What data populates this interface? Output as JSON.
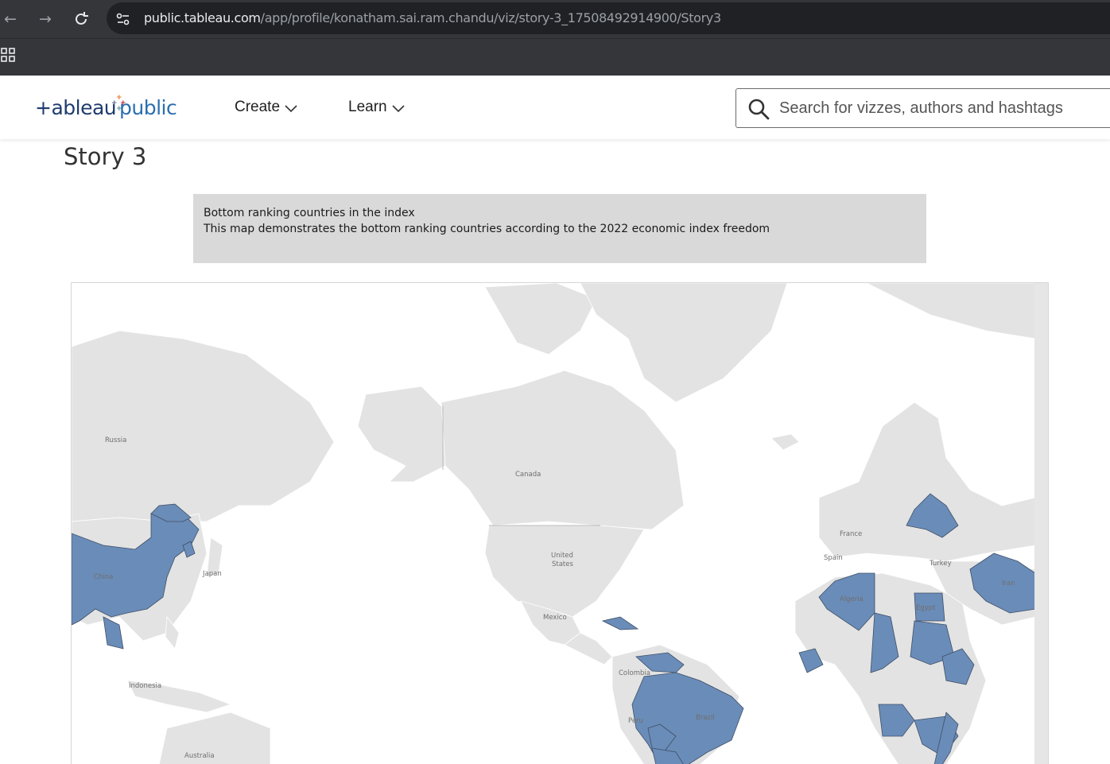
{
  "browser": {
    "url_host": "public.tableau.com",
    "url_path": "/app/profile/konatham.sai.ram.chandu/viz/story-3_17508492914900/Story3"
  },
  "header": {
    "logo_text_left": "+ableau",
    "logo_text_right": "public",
    "nav": [
      {
        "label": "Create"
      },
      {
        "label": "Learn"
      }
    ],
    "search_placeholder": "Search for vizzes, authors and hashtags"
  },
  "page": {
    "title": "Story 3",
    "caption": {
      "line1": "Bottom ranking countries in the index",
      "line2": "This map demonstrates the bottom ranking countries according to the 2022 economic index freedom"
    }
  },
  "map": {
    "highlight_color": "#6a8cb8",
    "land_color": "#e3e3e3",
    "labels": {
      "russia": "Russia",
      "canada": "Canada",
      "china": "China",
      "japan": "Japan",
      "us": "United",
      "us2": "States",
      "mexico": "Mexico",
      "indonesia": "Indonesia",
      "australia": "Australia",
      "colombia": "Colombia",
      "peru": "Peru",
      "brazil": "Brazil",
      "france": "France",
      "spain": "Spain",
      "turkey": "Turkey",
      "algeria": "Algeria",
      "egypt": "Egypt",
      "iran": "Iran"
    }
  }
}
